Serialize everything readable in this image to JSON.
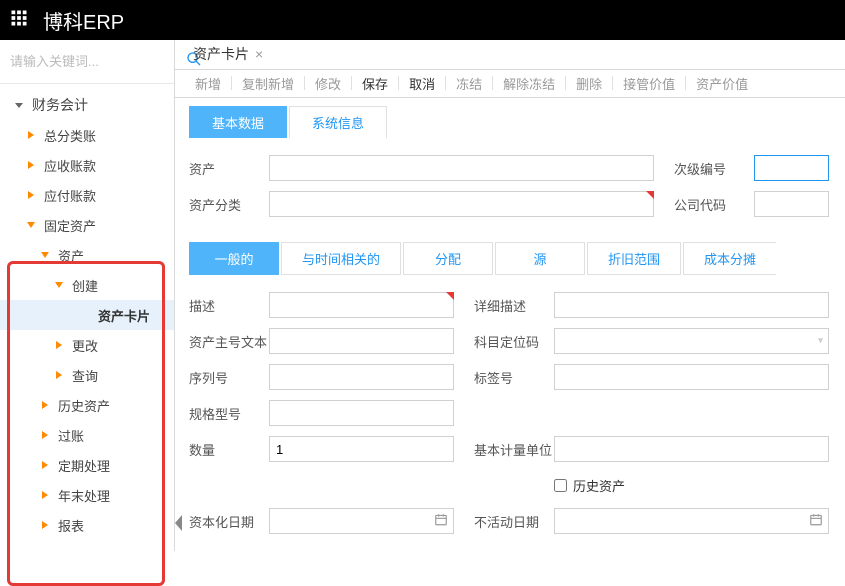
{
  "header": {
    "logo": "博科ERP"
  },
  "sidebar": {
    "search_placeholder": "请输入关键词...",
    "top_group": "财务会计",
    "tree": {
      "item1": "总分类账",
      "item2": "应收账款",
      "item3": "应付账款",
      "item4": "固定资产",
      "item4_1": "资产",
      "item4_1_1": "创建",
      "item4_1_1_1": "资产卡片",
      "item4_1_2": "更改",
      "item4_1_3": "查询",
      "item4_2": "历史资产",
      "item4_3": "过账",
      "item4_4": "定期处理",
      "item4_5": "年末处理",
      "item4_6": "报表"
    }
  },
  "tab": {
    "title": "资产卡片"
  },
  "toolbar": {
    "new": "新增",
    "copy_new": "复制新增",
    "modify": "修改",
    "save": "保存",
    "cancel": "取消",
    "freeze": "冻结",
    "unfreeze": "解除冻结",
    "delete": "删除",
    "takeover_value": "接管价值",
    "asset_value": "资产价值"
  },
  "sub_tabs": {
    "basic": "基本数据",
    "system": "系统信息"
  },
  "form_top": {
    "asset": "资产",
    "sub_number": "次级编号",
    "asset_class": "资产分类",
    "company_code": "公司代码"
  },
  "section_tabs": {
    "general": "一般的",
    "time": "与时间相关的",
    "alloc": "分配",
    "source": "源",
    "depr_range": "折旧范围",
    "cost_split": "成本分摊"
  },
  "form_fields": {
    "desc": "描述",
    "detail_desc": "详细描述",
    "asset_main_text": "资产主号文本",
    "account_loc_code": "科目定位码",
    "serial": "序列号",
    "tag": "标签号",
    "spec": "规格型号",
    "quantity": "数量",
    "quantity_value": "1",
    "base_unit": "基本计量单位",
    "history_asset": "历史资产",
    "cap_date": "资本化日期",
    "inactive_date": "不活动日期"
  }
}
